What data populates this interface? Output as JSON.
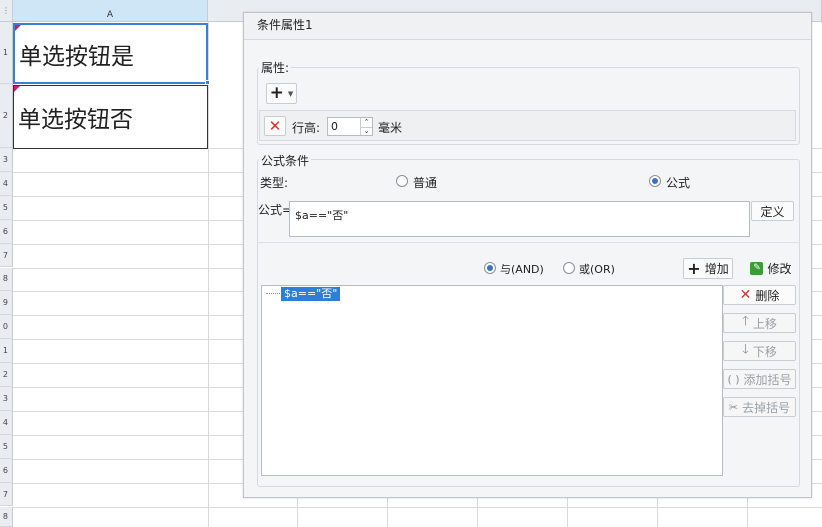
{
  "sheet": {
    "column_header": "A",
    "row_numbers": [
      "1",
      "2",
      "3",
      "4",
      "5",
      "6",
      "7",
      "8",
      "9",
      "0",
      "1",
      "2",
      "3",
      "4",
      "5",
      "6",
      "7",
      "8"
    ],
    "cells": {
      "a1": "单选按钮是",
      "a2": "单选按钮否"
    }
  },
  "dialog": {
    "title": "条件属性1",
    "properties": {
      "group_label": "属性:",
      "add_icon": "plus-icon",
      "row_height_label": "行高:",
      "row_height_value": "0",
      "unit": "毫米"
    },
    "formula_condition": {
      "group_label": "公式条件",
      "type_label": "类型:",
      "radio_normal": "普通",
      "radio_formula": "公式",
      "selected_type": "公式",
      "formula_label": "公式=",
      "formula_value": "$a==\"否\"",
      "define_button": "定义"
    },
    "conditions": {
      "and_label": "与(AND)",
      "or_label": "或(OR)",
      "selected_logic": "AND",
      "add_button": "增加",
      "edit_button": "修改",
      "items": [
        "$a==\"否\""
      ],
      "side_buttons": {
        "delete": "删除",
        "move_up": "上移",
        "move_down": "下移",
        "add_bracket": "添加括号",
        "remove_bracket": "去掉括号"
      }
    }
  },
  "colors": {
    "accent": "#2e7fd8",
    "delete_red": "#d9322d",
    "cell_mark": "#c21f7b"
  }
}
